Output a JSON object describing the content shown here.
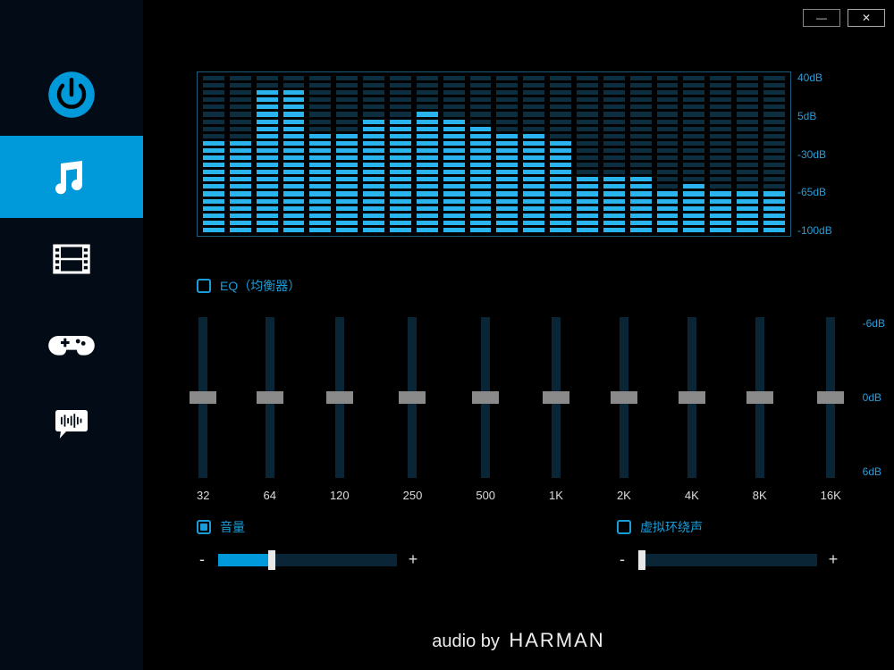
{
  "window": {
    "minimize": "—",
    "close": "✕"
  },
  "sidebar": {
    "items": [
      {
        "id": "power",
        "icon": "power-icon"
      },
      {
        "id": "music",
        "icon": "music-icon",
        "active": true
      },
      {
        "id": "video",
        "icon": "film-icon"
      },
      {
        "id": "game",
        "icon": "gamepad-icon"
      },
      {
        "id": "voice",
        "icon": "voice-bubble-icon"
      }
    ]
  },
  "spectrum": {
    "db_labels": [
      "40dB",
      "5dB",
      "-30dB",
      "-65dB",
      "-100dB"
    ],
    "segments_total": 22,
    "bars_peak": [
      13,
      13,
      20,
      20,
      14,
      14,
      16,
      16,
      17,
      16,
      15,
      14,
      14,
      13,
      8,
      8,
      8,
      6,
      7,
      6,
      6,
      6
    ]
  },
  "eq": {
    "checkbox_label": "EQ（均衡器）",
    "checked": false,
    "db_labels": [
      "-6dB",
      "0dB",
      "6dB"
    ],
    "freqs": [
      "32",
      "64",
      "120",
      "250",
      "500",
      "1K",
      "2K",
      "4K",
      "8K",
      "16K"
    ],
    "values": [
      0.5,
      0.5,
      0.5,
      0.5,
      0.5,
      0.5,
      0.5,
      0.5,
      0.5,
      0.5
    ]
  },
  "volume": {
    "label": "音量",
    "checked": true,
    "minus": "-",
    "plus": "+",
    "value": 0.3
  },
  "surround": {
    "label": "虚拟环绕声",
    "checked": false,
    "minus": "-",
    "plus": "+",
    "value": 0.0
  },
  "footer": {
    "prefix": "audio by",
    "brand": "HARMAN"
  }
}
